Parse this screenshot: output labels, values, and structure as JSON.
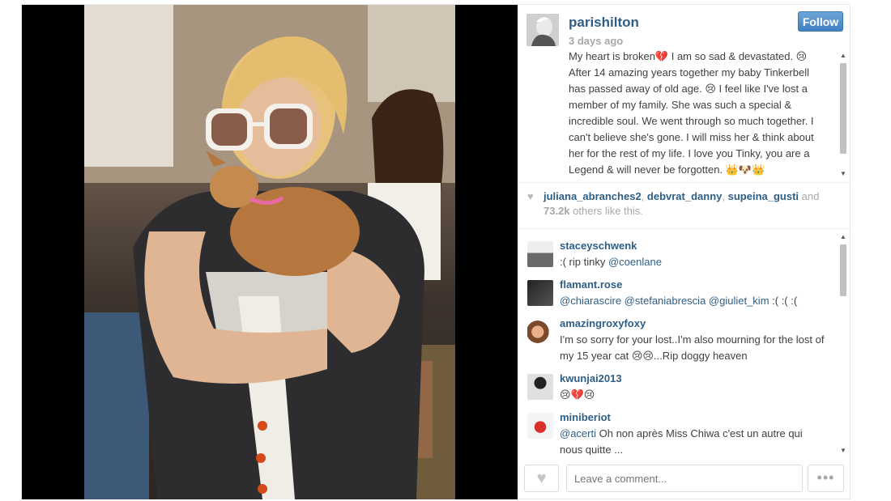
{
  "post": {
    "username": "parishilton",
    "time": "3 days ago",
    "follow_label": "Follow",
    "caption": "My heart is broken💔 I am so sad & devastated. 😢 After 14 amazing years together my baby Tinkerbell has passed away of old age. 😢 I feel like I've lost a member of my family. She was such a special & incredible soul. We went through so much together. I can't believe she's gone. I will miss her & think about her for the rest of my life. I love you Tinky, you are a Legend & will never be forgotten. 👑🐶👑"
  },
  "likes": {
    "users": [
      "juliana_abranches2",
      "debvrat_danny",
      "supeina_gusti"
    ],
    "and_label": "and",
    "count": "73.2k",
    "suffix": "others like this."
  },
  "comments": [
    {
      "user": "staceyschwenk",
      "text_pre": ":( rip tinky ",
      "mentions": "@coenlane",
      "text_post": ""
    },
    {
      "user": "flamant.rose",
      "text_pre": "",
      "mentions": "@chiarascire @stefaniabrescia @giuliet_kim",
      "text_post": " :( :( :("
    },
    {
      "user": "amazingroxyfoxy",
      "text_pre": "I'm so sorry for your lost..I'm also mourning for the lost of my 15 year cat 😢😢...Rip doggy heaven",
      "mentions": "",
      "text_post": ""
    },
    {
      "user": "kwunjai2013",
      "text_pre": "😢💔😢",
      "mentions": "",
      "text_post": ""
    },
    {
      "user": "miniberiot",
      "text_pre": "",
      "mentions": "@acerti",
      "text_post": " Oh non après Miss Chiwa c'est un autre qui nous quitte ..."
    }
  ],
  "footer": {
    "comment_placeholder": "Leave a comment...",
    "more_label": "•••"
  },
  "icons": {
    "like": "heart-icon",
    "more": "more-dots-icon",
    "scroll_up": "scroll-up-arrow-icon",
    "scroll_down": "scroll-down-arrow-icon"
  },
  "colors": {
    "link": "#2e5e86",
    "follow_button": "#3f81c4",
    "muted": "#a5a7aa"
  }
}
